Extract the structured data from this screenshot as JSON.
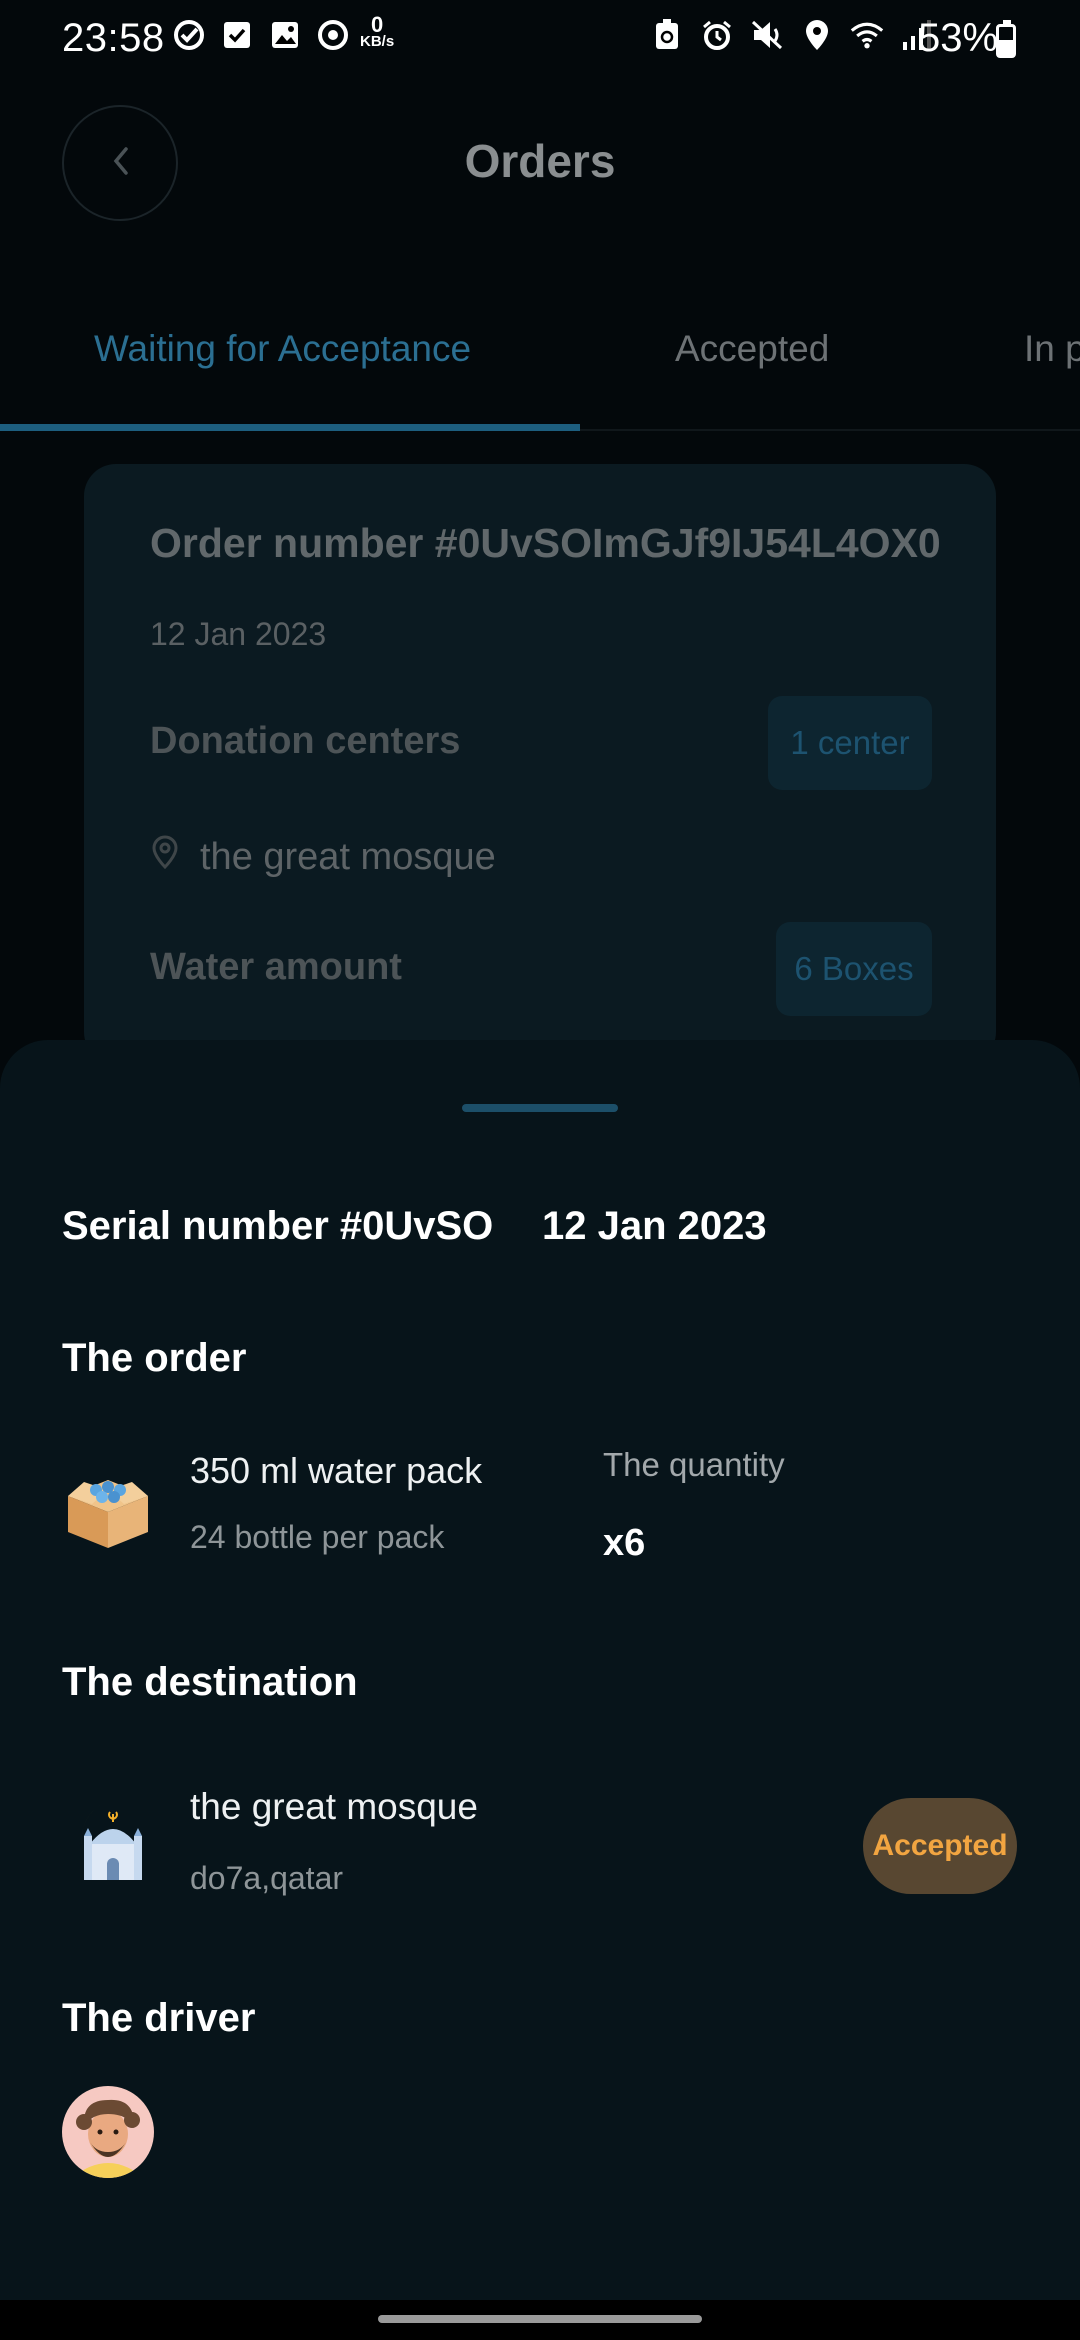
{
  "status_bar": {
    "time": "23:58",
    "kbs_value": "0",
    "kbs_unit": "KB/s",
    "battery": "53%",
    "battery_level": 0.53,
    "icons_left": [
      "check-circle-icon",
      "checkbox-icon",
      "image-icon",
      "sync-icon"
    ],
    "icons_right": [
      "lock-battery-icon",
      "alarm-icon",
      "mute-icon",
      "location-icon",
      "wifi-icon",
      "signal-icon",
      "battery-icon"
    ]
  },
  "header": {
    "title": "Orders",
    "back_icon": "chevron-left-icon"
  },
  "tabs": [
    {
      "label": "Waiting for Acceptance",
      "active": true
    },
    {
      "label": "Accepted",
      "active": false
    },
    {
      "label": "In p",
      "active": false
    }
  ],
  "order_card": {
    "title": "Order number #0UvSOImGJf9IJ54L4OX0",
    "date": "12 Jan 2023",
    "donation_label": "Donation centers",
    "donation_value": "1 center",
    "location": "the great mosque",
    "water_label": "Water amount",
    "water_value": "6 Boxes"
  },
  "sheet": {
    "serial": "Serial number #0UvSO",
    "date": "12 Jan 2023",
    "order_heading": "The order",
    "product_name": "350 ml water pack",
    "product_sub": "24 bottle per pack",
    "quantity_label": "The quantity",
    "quantity_value": "x6",
    "destination_heading": "The destination",
    "destination_name": "the great mosque",
    "destination_sub": "do7a,qatar",
    "status": "Accepted",
    "driver_heading": "The driver"
  },
  "colors": {
    "background": "#03080b",
    "sheet": "#07141a",
    "accent": "#2b6f92",
    "badge_bg": "#584731",
    "badge_text": "#f2a541"
  }
}
